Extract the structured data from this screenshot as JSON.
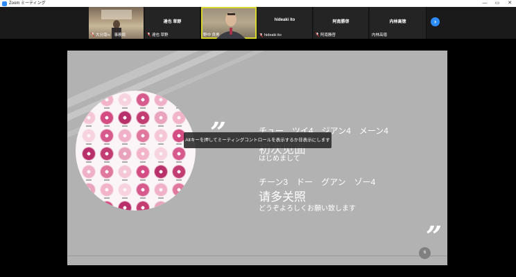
{
  "window": {
    "title": "Zoom ミーティング",
    "controls": [
      "—",
      "▭",
      "✕"
    ]
  },
  "participants": [
    {
      "label": "大分南rc　事務局",
      "name": "",
      "video": true
    },
    {
      "label": "達也 草野",
      "name": "達也 草野",
      "video": false
    },
    {
      "label": "野中 良男",
      "name": "",
      "video": true,
      "active": true
    },
    {
      "label": "hideaki ito",
      "name": "hideaki ito",
      "video": false
    },
    {
      "label": "阿南勝啓",
      "name": "阿南勝啓",
      "video": false
    },
    {
      "label": "内林高徳",
      "name": "内林高徳",
      "video": false
    }
  ],
  "strip": {
    "next_icon": "›"
  },
  "slide": {
    "quote_open": "”",
    "quote_close": "”",
    "line1_reading": "チュー　ツイ4　ジアン4　メーン4",
    "line1_chinese": "初次见面",
    "line1_japanese": "はじめまして",
    "line2_reading": "チーン3　ドー　グアン　ゾー4",
    "line2_chinese": "请多关照",
    "line2_japanese": "どうぞよろしくお願い致します",
    "page_number": "6"
  },
  "tooltip": {
    "text": "Altキーを押してミーティングコントロールを表示するか非表示にします"
  },
  "colors": {
    "accent": "#2d8cff",
    "active_speaker": "#d8d82a",
    "slide_bg": "#b2b2b2",
    "flower_colors": [
      "#e8a3bd",
      "#d65a8c",
      "#f5c6d6",
      "#c23d72",
      "#f7d3e0",
      "#e0789e",
      "#b8306a",
      "#f2b4c9",
      "#efb0c8",
      "#d44d82"
    ]
  }
}
